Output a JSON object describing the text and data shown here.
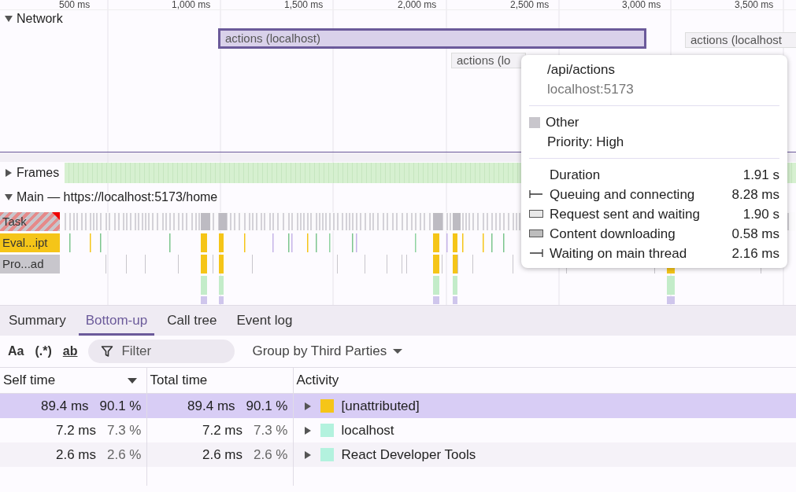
{
  "ruler": {
    "ticks": [
      "500 ms",
      "1,000 ms",
      "1,500 ms",
      "2,000 ms",
      "2,500 ms",
      "3,000 ms",
      "3,500 ms"
    ]
  },
  "network": {
    "label": "Network",
    "expanded": true,
    "requests": [
      {
        "label": "actions (localhost)",
        "selected": true
      },
      {
        "label": "actions (localhost",
        "selected": false
      },
      {
        "label": "actions (lo",
        "selected": false
      }
    ]
  },
  "frames": {
    "label": "Frames",
    "expanded": false
  },
  "main": {
    "label": "Main — https://localhost:5173/home",
    "expanded": true,
    "entries": [
      {
        "label": "Task",
        "color": "#c8c6cc",
        "long_task": true
      },
      {
        "label": "Eval...ipt",
        "color": "#f5c518",
        "long_task": false
      },
      {
        "label": "Pro...ad",
        "color": "#c8c6cc",
        "long_task": false
      }
    ]
  },
  "tooltip": {
    "url": "/api/actions",
    "host": "localhost:5173",
    "resource_type": "Other",
    "priority": "Priority: High",
    "timings": [
      {
        "kind": "total",
        "label": "Duration",
        "value": "1.91 s"
      },
      {
        "kind": "queuing",
        "label": "Queuing and connecting",
        "value": "8.28 ms"
      },
      {
        "kind": "waiting",
        "label": "Request sent and waiting",
        "value": "1.90 s"
      },
      {
        "kind": "downloading",
        "label": "Content downloading",
        "value": "0.58 ms"
      },
      {
        "kind": "main_thread",
        "label": "Waiting on main thread",
        "value": "2.16 ms"
      }
    ]
  },
  "tabs": [
    {
      "label": "Summary",
      "selected": false
    },
    {
      "label": "Bottom-up",
      "selected": true
    },
    {
      "label": "Call tree",
      "selected": false
    },
    {
      "label": "Event log",
      "selected": false
    }
  ],
  "toolbar": {
    "match_case": "Aa",
    "regex": "(.*)",
    "whole_word": "ab",
    "filter": {
      "placeholder": "Filter"
    },
    "group_by": "Group by Third Parties"
  },
  "table": {
    "columns": [
      {
        "label": "Self time",
        "sorted": true
      },
      {
        "label": "Total time",
        "sorted": false
      },
      {
        "label": "Activity",
        "sorted": false
      }
    ],
    "rows": [
      {
        "self_time": "89.4 ms",
        "self_percent": "90.1 %",
        "total_time": "89.4 ms",
        "total_percent": "90.1 %",
        "activity": "[unattributed]",
        "color": "#f5c518",
        "selected": true
      },
      {
        "self_time": "7.2 ms",
        "self_percent": "7.3 %",
        "total_time": "7.2 ms",
        "total_percent": "7.3 %",
        "activity": "localhost",
        "color": "#b3f2de",
        "selected": false
      },
      {
        "self_time": "2.6 ms",
        "self_percent": "2.6 %",
        "total_time": "2.6 ms",
        "total_percent": "2.6 %",
        "activity": "React Developer Tools",
        "color": "#b3f2de",
        "selected": false
      }
    ]
  }
}
